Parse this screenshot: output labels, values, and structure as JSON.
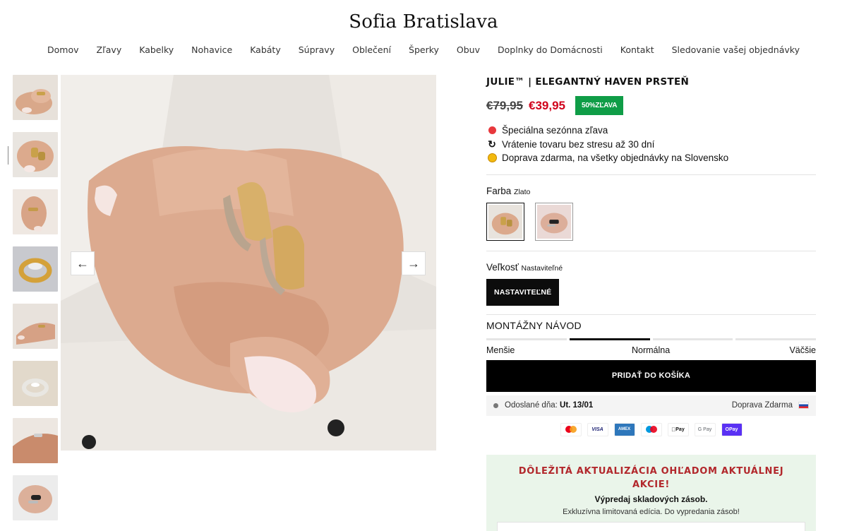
{
  "store": {
    "title": "Sofia Bratislava"
  },
  "nav": [
    "Domov",
    "Zľavy",
    "Kabelky",
    "Nohavice",
    "Kabáty",
    "Súpravy",
    "Oblečení",
    "Šperky",
    "Obuv",
    "Doplnky do Domácnosti",
    "Kontakt",
    "Sledovanie vašej objednávky"
  ],
  "gallery": {
    "prev_icon": "←",
    "next_icon": "→",
    "active_index": 1
  },
  "product": {
    "title": "JULIE™ | ELEGANTNÝ HAVEN PRSTEŇ",
    "old_price": "€79,95",
    "new_price": "€39,95",
    "badge": "50%ZĽAVA",
    "features": [
      "Špeciálna sezónna zľava",
      "Vrátenie tovaru bez stresu až 30 dní",
      "Doprava zdarma, na všetky objednávky na Slovensko"
    ],
    "color_label": "Farba",
    "color_value": "Zlato",
    "size_label": "Veľkosť",
    "size_value": "Nastaviteľné",
    "size_option": "NASTAVITEĽNÉ",
    "guide_title": "MONTÁŽNY NÁVOD",
    "guide_labels": {
      "small": "Menšie",
      "normal": "Normálna",
      "large": "Väčšie"
    },
    "cart_button": "PRIDAŤ DO KOŠÍKA",
    "shipping_label": "Odoslané dňa:",
    "shipping_date": "Ut. 13/01",
    "shipping_free": "Doprava Zdarma"
  },
  "payments": [
    "mastercard-icon",
    "VISA",
    "AMEX",
    "maestro-icon",
    "Pay",
    "G Pay",
    "OPay"
  ],
  "notice": {
    "title": "DÔLEŽITÁ AKTUALIZÁCIA OHĽADOM AKTUÁLNEJ AKCIE!",
    "subtitle": "Výpredaj skladových zásob.",
    "text": "Exkluzívna limitovaná edícia. Do vypredania zásob!"
  },
  "colors": {
    "accent_red": "#d0021b",
    "badge_green": "#0f9d47",
    "notice_bg": "#eaf5ea",
    "notice_title": "#b2282c"
  }
}
